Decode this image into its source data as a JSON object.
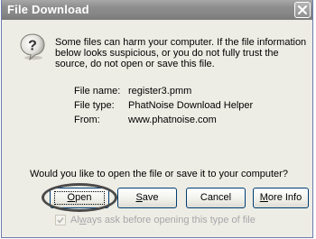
{
  "window": {
    "title": "File Download",
    "close_icon": "close-icon"
  },
  "icons": {
    "question": "question-mark-icon",
    "checkmark": "checkmark-icon"
  },
  "warning": {
    "text": "Some files can harm your computer. If the file information below looks suspicious, or you do not fully trust the source, do not open or save this file."
  },
  "file_info": {
    "name_label": "File name:",
    "name_value": "register3.pmm",
    "type_label": "File type:",
    "type_value": "PhatNoise Download Helper",
    "from_label": "From:",
    "from_value": "www.phatnoise.com"
  },
  "question": "Would you like to open the file or save it to your computer?",
  "buttons": {
    "open_key": "O",
    "open_rest": "pen",
    "save_key": "S",
    "save_rest": "ave",
    "cancel": "Cancel",
    "more_key": "M",
    "more_rest": "ore Info"
  },
  "checkbox": {
    "checked": true,
    "pre": "Al",
    "key": "w",
    "post": "ays ask before opening this type of file"
  },
  "colors": {
    "titlebar": "#8e8e8e",
    "dialog_bg": "#eeede5",
    "button_border": "#003c74",
    "disabled_text": "#a7a6aa",
    "annotation_oval": "#4a4a4a"
  }
}
